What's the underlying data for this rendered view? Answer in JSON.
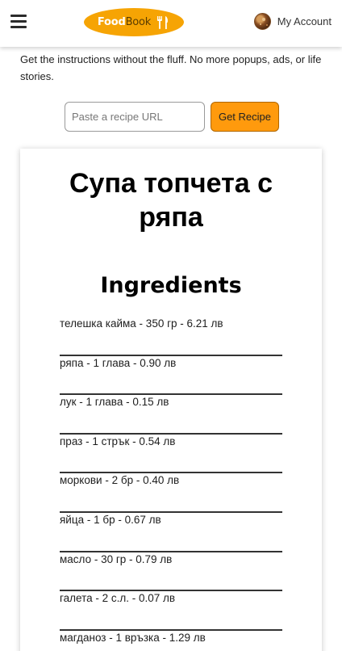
{
  "header": {
    "logo_food": "Food",
    "logo_book": "Book",
    "account_label": "My Account"
  },
  "tagline": "Get the instructions without the fluff. No more popups, ads, or life stories.",
  "search": {
    "placeholder": "Paste a recipe URL",
    "button_label": "Get Recipe"
  },
  "recipe": {
    "title": "Супа топчета с ряпа",
    "ingredients_heading": "Ingredients",
    "ingredients": [
      "телешка кайма - 350 гр - 6.21 лв",
      "ряпа - 1 глава - 0.90 лв",
      "лук - 1 глава - 0.15 лв",
      "праз - 1 стрък - 0.54 лв",
      "моркови - 2 бр - 0.40 лв",
      "яйца - 1 бр - 0.67 лв",
      "масло - 30 гр - 0.79 лв",
      "галета - 2 с.л. - 0.07 лв",
      "магданоз - 1 връзка - 1.29 лв"
    ]
  },
  "colors": {
    "accent": "#ff9a0d",
    "logo_bg": "#f6a404"
  },
  "icons": [
    "menu-icon",
    "cutlery-icon",
    "avatar"
  ]
}
